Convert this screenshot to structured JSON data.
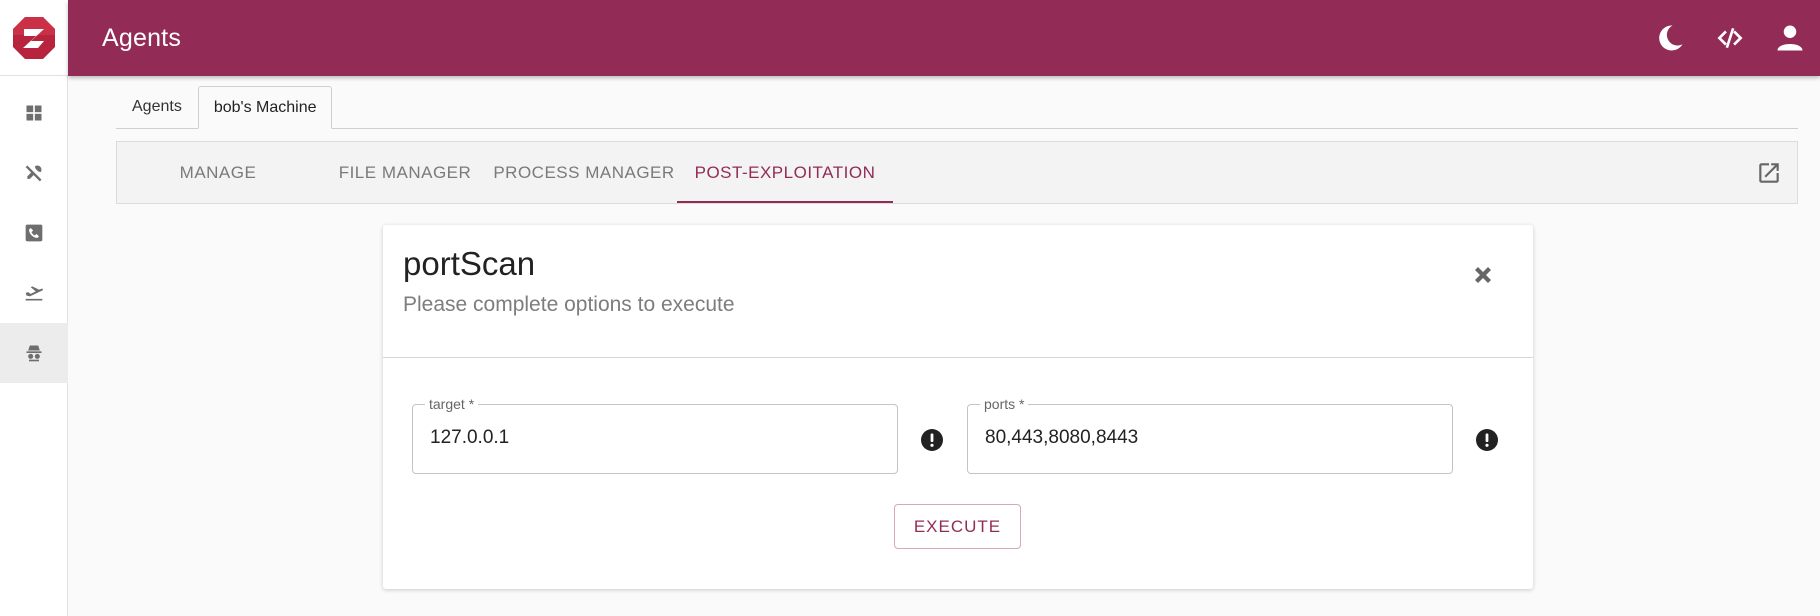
{
  "app": {
    "title": "Agents",
    "accent_color": "#922c56"
  },
  "sidebar": {
    "items": [
      {
        "icon": "dashboard-icon"
      },
      {
        "icon": "tools-icon"
      },
      {
        "icon": "phone-icon"
      },
      {
        "icon": "airplane-takeoff-icon"
      },
      {
        "icon": "spy-icon",
        "active": true
      }
    ]
  },
  "topbar": {
    "icons": [
      "moon-icon",
      "code-icon",
      "account-icon"
    ]
  },
  "agent_tabs": [
    {
      "label": "Agents"
    },
    {
      "label": "bob's Machine",
      "active": true
    }
  ],
  "sub_tabs": [
    {
      "label": "MANAGE"
    },
    {
      "label": "FILE MANAGER"
    },
    {
      "label": "PROCESS MANAGER"
    },
    {
      "label": "POST-EXPLOITATION",
      "active": true
    }
  ],
  "module": {
    "title": "portScan",
    "subtitle": "Please complete options to execute",
    "fields": [
      {
        "label": "target *",
        "value": "127.0.0.1"
      },
      {
        "label": "ports *",
        "value": "80,443,8080,8443"
      }
    ],
    "execute_label": "EXECUTE"
  }
}
